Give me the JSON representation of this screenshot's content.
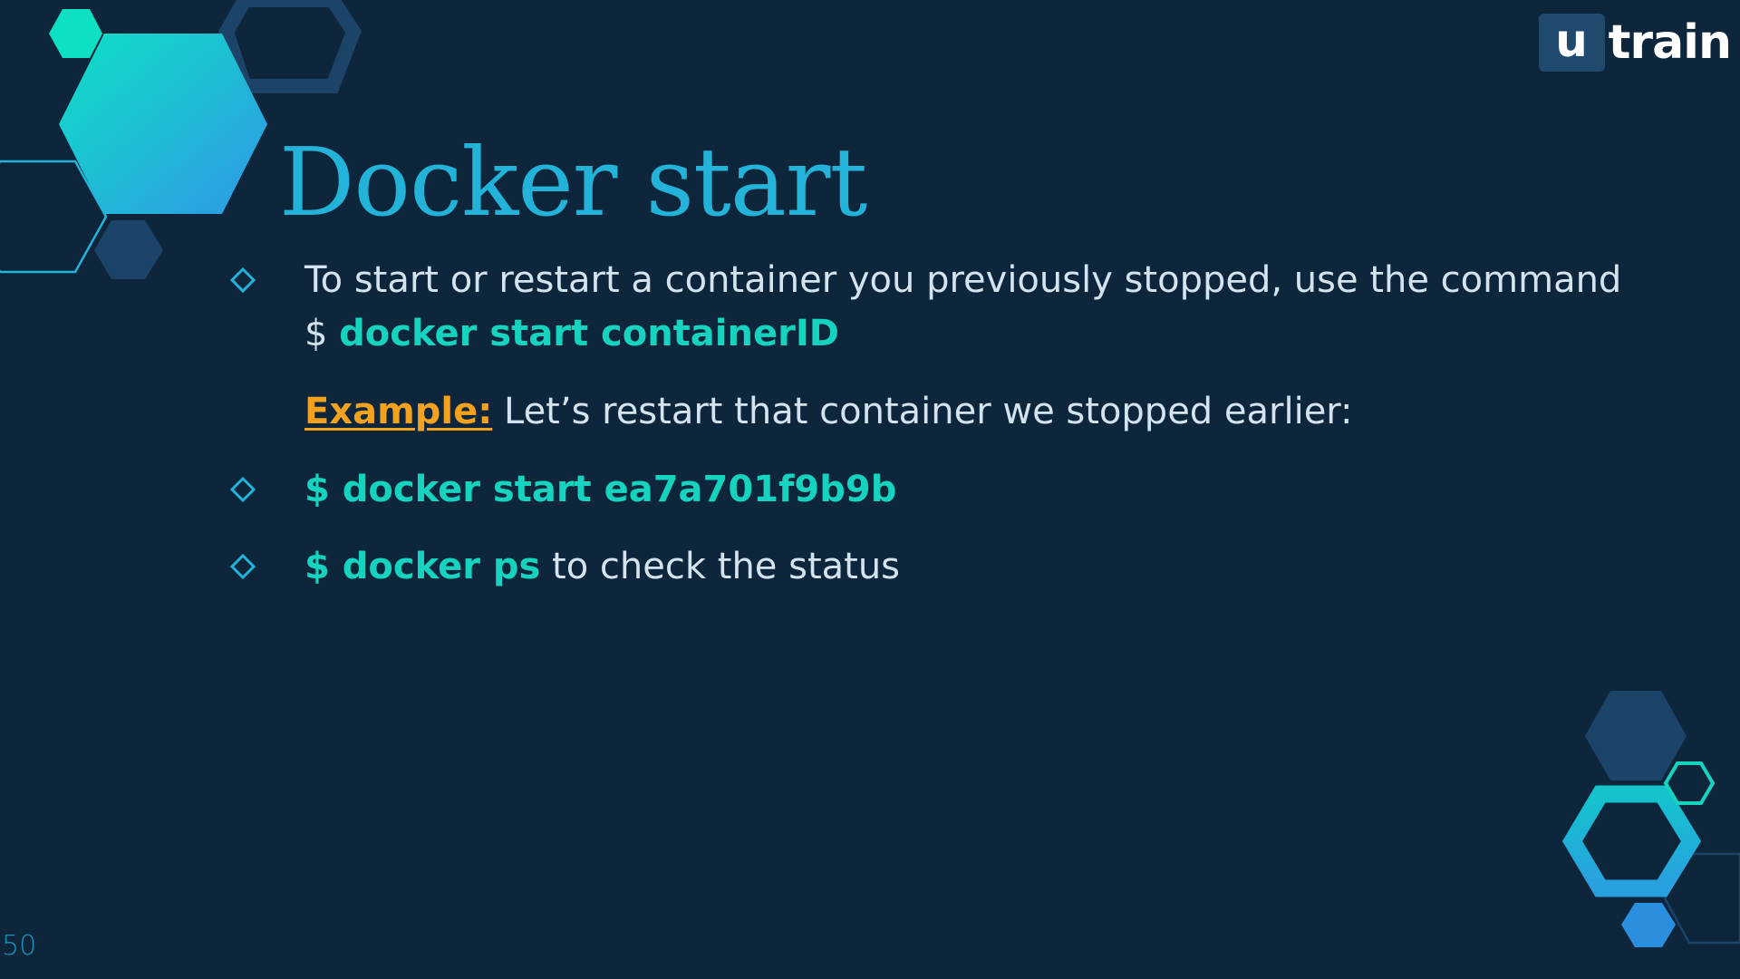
{
  "logo": {
    "mark": "u",
    "word": "train"
  },
  "title": "Docker start",
  "page_number": "50",
  "bullet_icon": "diamond-outline-icon",
  "colors": {
    "background": "#0e263b",
    "title": "#23b2d8",
    "body_text": "#d3e3ef",
    "command": "#16d3bf",
    "example": "#f2a21d",
    "bullet": "#23b2d8"
  },
  "content": {
    "item1": {
      "text": "To start or restart a container you previously stopped, use the command",
      "prompt": "$ ",
      "command": "docker start containerID"
    },
    "example": {
      "label": "Example:",
      "text": " Let’s restart that container we stopped earlier:"
    },
    "item2": {
      "command": "$ docker start ea7a701f9b9b"
    },
    "item3": {
      "command": "$ docker ps",
      "text": " to check the status"
    }
  }
}
